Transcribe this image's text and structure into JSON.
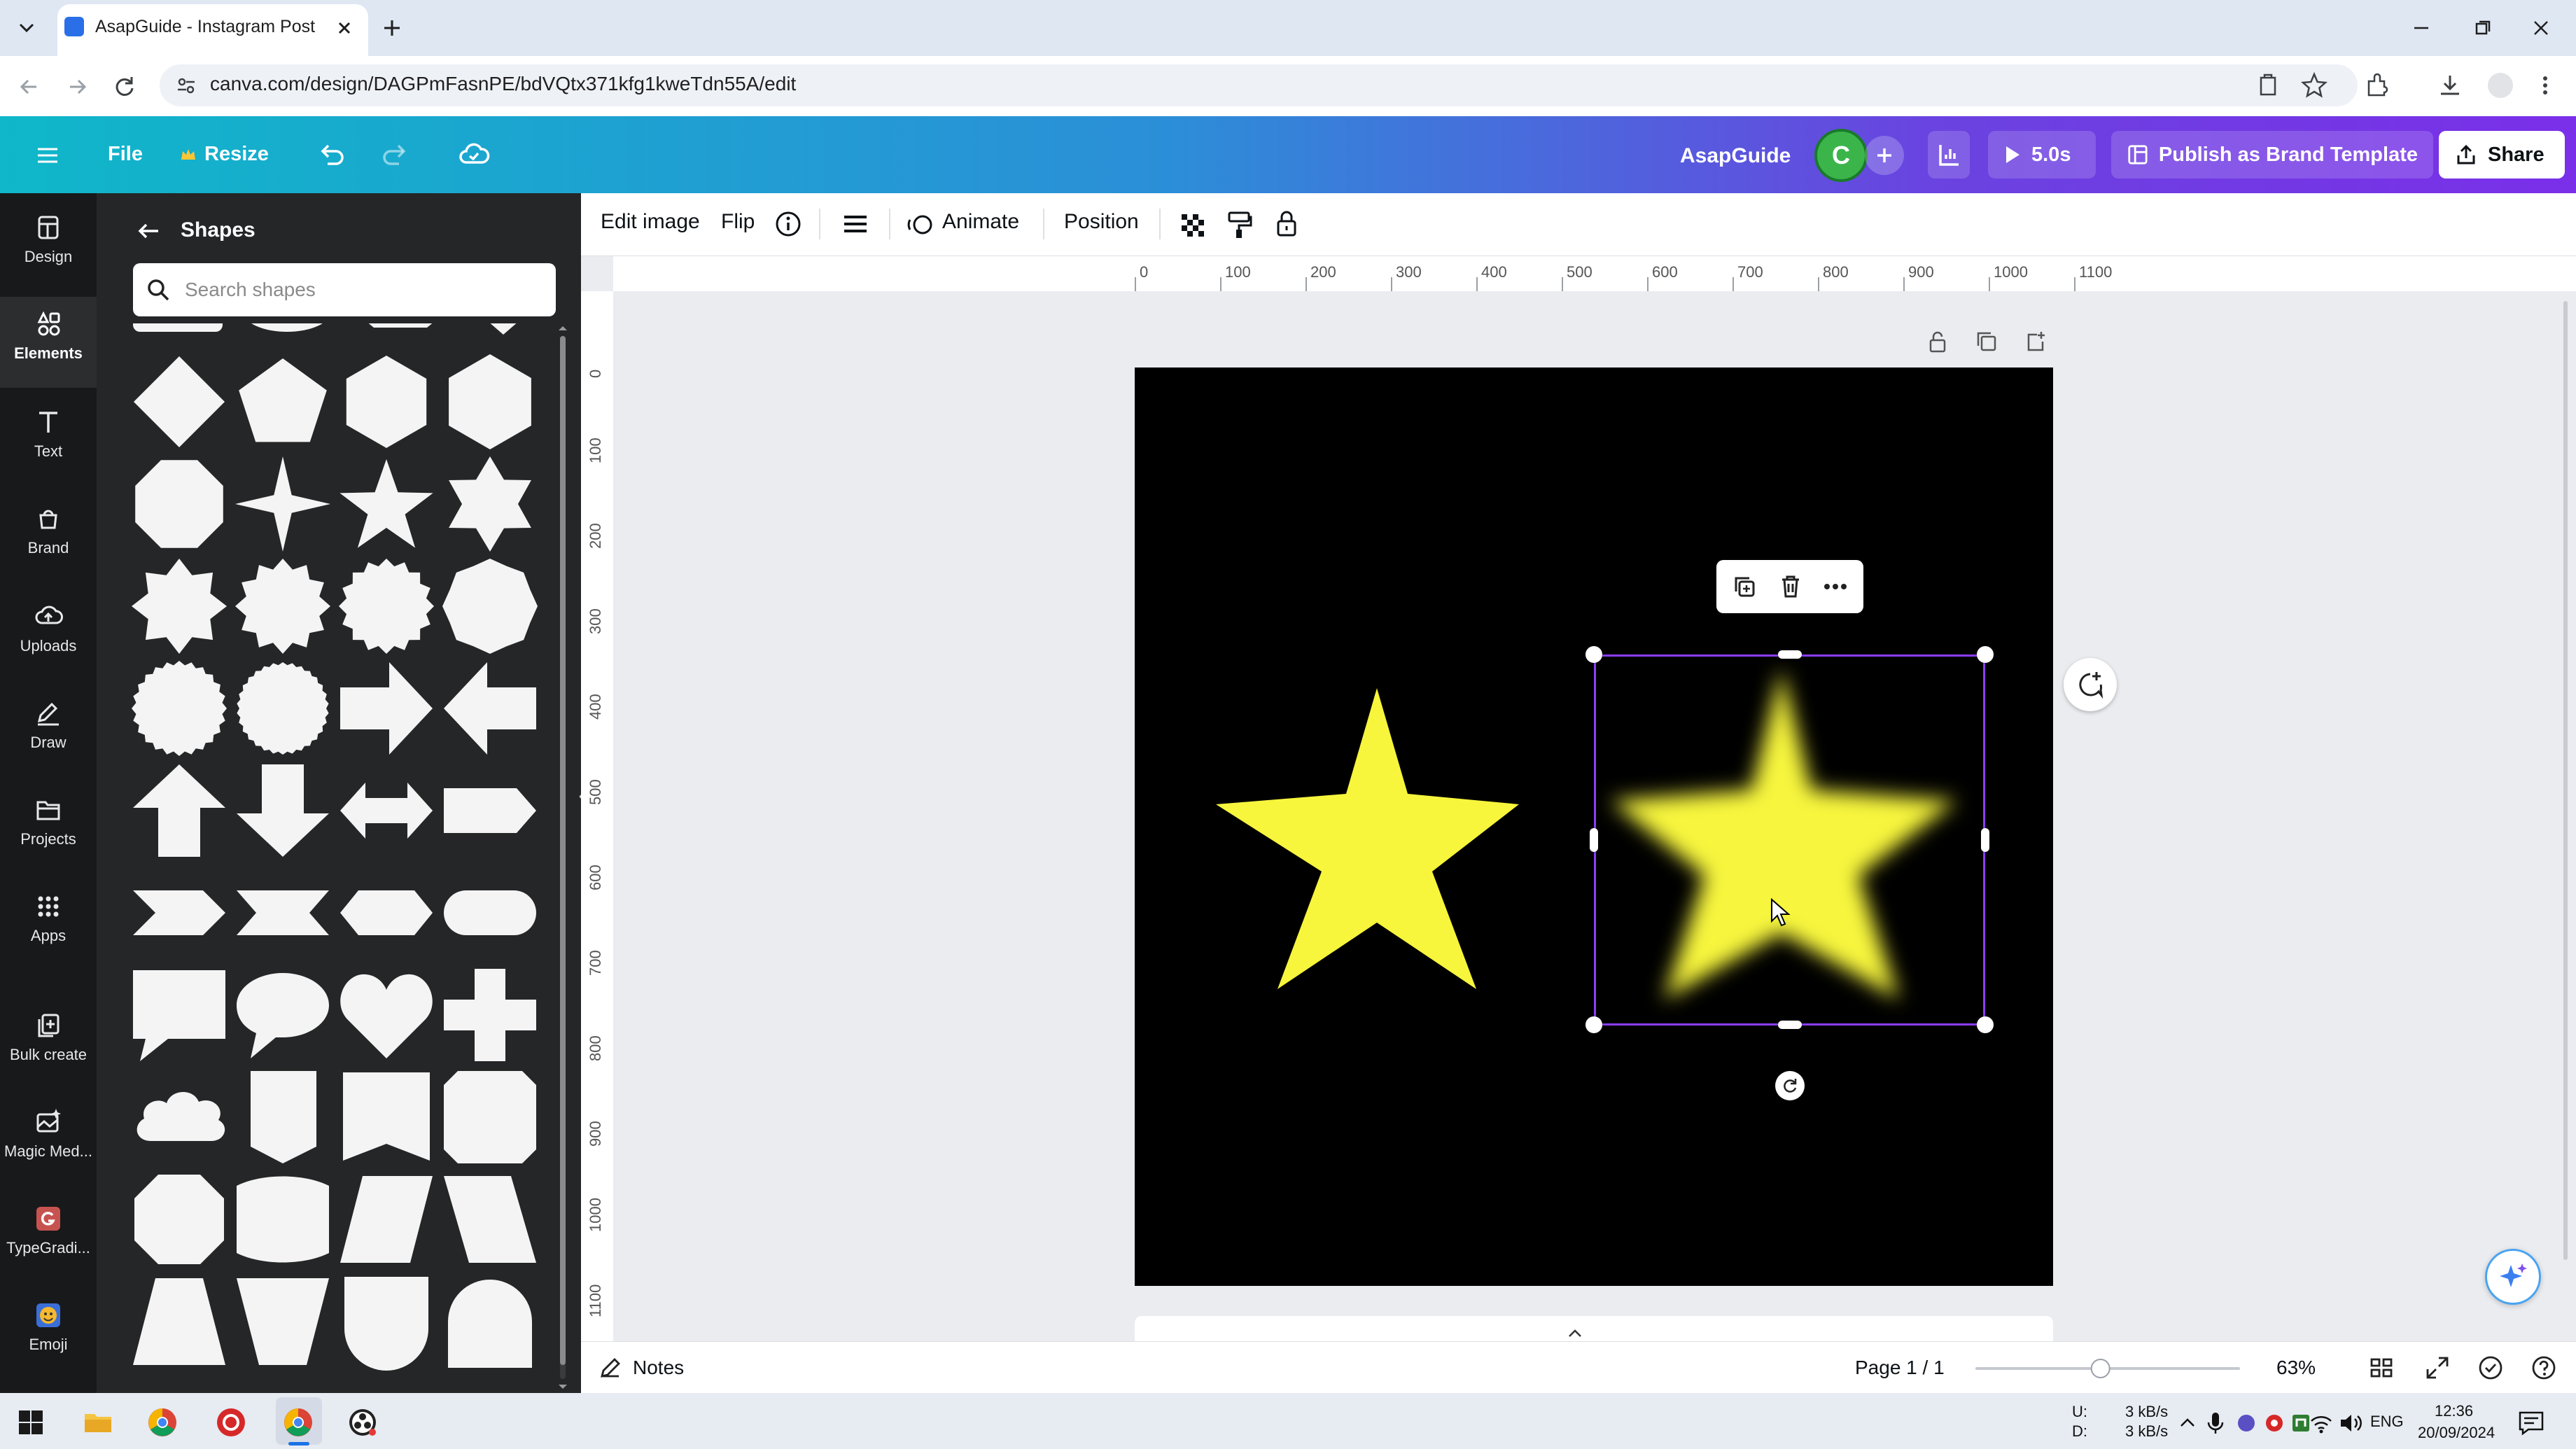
{
  "browser": {
    "tab_title": "AsapGuide - Instagram Post",
    "url": "canva.com/design/DAGPmFasnPE/bdVQtx371kfg1kweTdn55A/edit"
  },
  "header": {
    "file_label": "File",
    "resize_label": "Resize",
    "team_name": "AsapGuide",
    "avatar_initial": "C",
    "timer_label": "5.0s",
    "publish_label": "Publish as Brand Template",
    "share_label": "Share",
    "accent_color": "#7a2fe8"
  },
  "rail": {
    "items": [
      {
        "label": "Design",
        "icon": "design-icon"
      },
      {
        "label": "Elements",
        "icon": "elements-icon",
        "active": true
      },
      {
        "label": "Text",
        "icon": "text-icon"
      },
      {
        "label": "Brand",
        "icon": "brand-icon"
      },
      {
        "label": "Uploads",
        "icon": "uploads-icon"
      },
      {
        "label": "Draw",
        "icon": "draw-icon"
      },
      {
        "label": "Projects",
        "icon": "projects-icon"
      },
      {
        "label": "Apps",
        "icon": "apps-icon"
      },
      {
        "label": "Bulk create",
        "icon": "bulk-create-icon"
      },
      {
        "label": "Magic Med...",
        "icon": "magic-media-icon"
      },
      {
        "label": "TypeGradi...",
        "icon": "typegradient-icon"
      },
      {
        "label": "Emoji",
        "icon": "emoji-icon"
      }
    ]
  },
  "panel": {
    "title": "Shapes",
    "search_placeholder": "Search shapes",
    "shape_color": "#f4f4f4"
  },
  "toolbar": {
    "edit_image": "Edit image",
    "flip": "Flip",
    "animate": "Animate",
    "position": "Position"
  },
  "ruler": {
    "top": [
      "0",
      "100",
      "200",
      "300",
      "400",
      "500",
      "600",
      "700",
      "800",
      "900",
      "1000",
      "1100"
    ],
    "left": [
      "0",
      "100",
      "200",
      "300",
      "400",
      "500",
      "600",
      "700",
      "800",
      "900",
      "1000",
      "1100"
    ]
  },
  "canvas": {
    "background": "#000000",
    "star_color": "#f7f53c",
    "selection_color": "#8b3dff"
  },
  "bottom": {
    "notes_label": "Notes",
    "page_label": "Page 1 / 1",
    "zoom_label": "63%",
    "zoom_level": 0.63
  },
  "taskbar": {
    "net_up_label": "U:",
    "net_down_label": "D:",
    "net_up": "3 kB/s",
    "net_down": "3 kB/s",
    "lang": "ENG",
    "time": "12:36",
    "date": "20/09/2024"
  }
}
